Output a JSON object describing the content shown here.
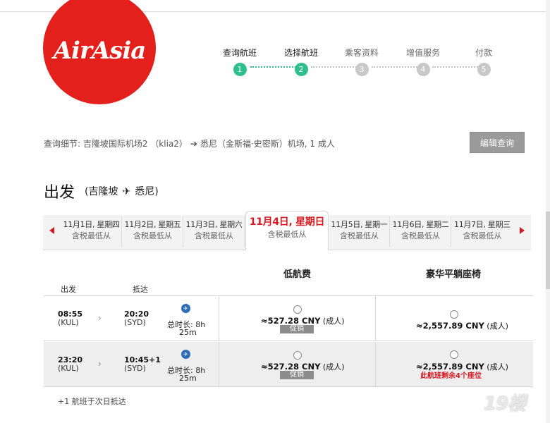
{
  "brand": {
    "name": "AirAsia",
    "logo_color": "#e3201b"
  },
  "steps": [
    {
      "label": "查询航班",
      "num": "1",
      "state": "done"
    },
    {
      "label": "选择航班",
      "num": "2",
      "state": "done"
    },
    {
      "label": "乘客资料",
      "num": "3",
      "state": "inactive"
    },
    {
      "label": "增值服务",
      "num": "4",
      "state": "inactive"
    },
    {
      "label": "付款",
      "num": "5",
      "state": "inactive"
    }
  ],
  "summary": {
    "prefix": "查询细节: 吉隆坡国际机场2 （klia2）",
    "destination": "悉尼（金斯福·史密斯）机场, 1 成人"
  },
  "edit_button": "编辑查询",
  "depart": {
    "title": "出发",
    "origin": "(吉隆坡",
    "destination": "悉尼)"
  },
  "dates": [
    {
      "label": "11月1日, 星期四",
      "sub": "含税最低从"
    },
    {
      "label": "11月2日, 星期五",
      "sub": "含税最低从"
    },
    {
      "label": "11月3日, 星期六",
      "sub": "含税最低从"
    },
    {
      "label": "11月4日, 星期日",
      "sub": "含税最低从",
      "active": true
    },
    {
      "label": "11月5日, 星期一",
      "sub": "含税最低从"
    },
    {
      "label": "11月6日, 星期二",
      "sub": "含税最低从"
    },
    {
      "label": "11月7日, 星期三",
      "sub": "含税最低从"
    }
  ],
  "fare_headers": {
    "low": "低航费",
    "premium": "豪华平躺座椅"
  },
  "columns": {
    "depart": "出发",
    "arrive": "抵达"
  },
  "flights": [
    {
      "dep_time": "08:55",
      "dep_code": "(KUL)",
      "arr_time": "20:20",
      "arr_code": "(SYD)",
      "duration": "总时长: 8h",
      "duration_min": "25m",
      "low_price": "≈527.28 CNY",
      "low_unit": "(成人)",
      "promo": "促销",
      "premium_price": "≈2,557.89 CNY",
      "premium_unit": "(成人)"
    },
    {
      "dep_time": "23:20",
      "dep_code": "(KUL)",
      "arr_time": "10:45+1",
      "arr_code": "(SYD)",
      "duration": "总时长: 8h",
      "duration_min": "25m",
      "low_price": "≈527.28 CNY",
      "low_unit": "(成人)",
      "promo": "促销",
      "premium_price": "≈2,557.89 CNY",
      "premium_unit": "(成人)",
      "seats_left": "此航班剩余4个座位"
    }
  ],
  "footnote": "+1 航班于次日抵达",
  "watermark": "19楼"
}
